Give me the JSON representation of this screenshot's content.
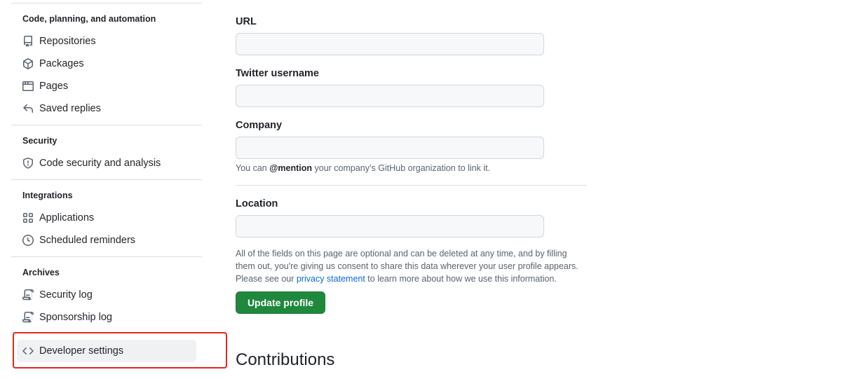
{
  "sidebar": {
    "sections": [
      {
        "title": "Code, planning, and automation",
        "items": [
          {
            "label": "Repositories",
            "icon": "repo-icon"
          },
          {
            "label": "Packages",
            "icon": "package-icon"
          },
          {
            "label": "Pages",
            "icon": "browser-icon"
          },
          {
            "label": "Saved replies",
            "icon": "reply-icon"
          }
        ]
      },
      {
        "title": "Security",
        "items": [
          {
            "label": "Code security and analysis",
            "icon": "shield-icon"
          }
        ]
      },
      {
        "title": "Integrations",
        "items": [
          {
            "label": "Applications",
            "icon": "apps-icon"
          },
          {
            "label": "Scheduled reminders",
            "icon": "clock-icon"
          }
        ]
      },
      {
        "title": "Archives",
        "items": [
          {
            "label": "Security log",
            "icon": "log-icon"
          },
          {
            "label": "Sponsorship log",
            "icon": "log-icon"
          }
        ]
      }
    ],
    "developer_settings": {
      "label": "Developer settings",
      "icon": "code-icon"
    }
  },
  "form": {
    "url": {
      "label": "URL",
      "value": ""
    },
    "twitter": {
      "label": "Twitter username",
      "value": ""
    },
    "company": {
      "label": "Company",
      "value": "",
      "note_prefix": "You can ",
      "note_bold": "@mention",
      "note_suffix": " your company’s GitHub organization to link it."
    },
    "location": {
      "label": "Location",
      "value": ""
    },
    "disclaimer_line1": "All of the fields on this page are optional and can be deleted at any time, and by filling",
    "disclaimer_line2": "them out, you're giving us consent to share this data wherever your user profile appears.",
    "disclaimer_line3_prefix": "Please see our ",
    "privacy_link": "privacy statement",
    "disclaimer_line3_suffix": " to learn more about how we use this information.",
    "update_button": "Update profile"
  },
  "contributions_heading": "Contributions",
  "colors": {
    "primary_button": "#1f883d",
    "link": "#0969da",
    "highlight": "#e5261c"
  }
}
